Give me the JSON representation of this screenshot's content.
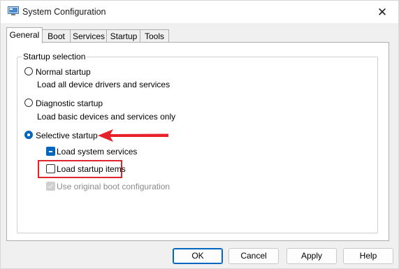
{
  "window": {
    "title": "System Configuration",
    "icon": "msconfig-app-icon",
    "close_glyph": "✕"
  },
  "tabs": [
    {
      "label": "General",
      "active": true
    },
    {
      "label": "Boot",
      "active": false
    },
    {
      "label": "Services",
      "active": false
    },
    {
      "label": "Startup",
      "active": false
    },
    {
      "label": "Tools",
      "active": false
    }
  ],
  "startup_selection": {
    "legend": "Startup selection",
    "options": [
      {
        "label": "Normal startup",
        "description": "Load all device drivers and services",
        "selected": false
      },
      {
        "label": "Diagnostic startup",
        "description": "Load basic devices and services only",
        "selected": false
      },
      {
        "label": "Selective startup",
        "description": "",
        "selected": true
      }
    ],
    "selective_options": [
      {
        "label": "Load system services",
        "state": "indeterminate",
        "enabled": true
      },
      {
        "label": "Load startup items",
        "state": "unchecked",
        "enabled": true
      },
      {
        "label": "Use original boot configuration",
        "state": "checked",
        "enabled": false
      }
    ]
  },
  "annotations": {
    "arrow_color": "#e8202a",
    "highlight_color": "#e0252b"
  },
  "buttons": {
    "ok": "OK",
    "cancel": "Cancel",
    "apply": "Apply",
    "help": "Help"
  },
  "colors": {
    "accent": "#0067c0",
    "disabled_text": "#8a8a8a"
  }
}
